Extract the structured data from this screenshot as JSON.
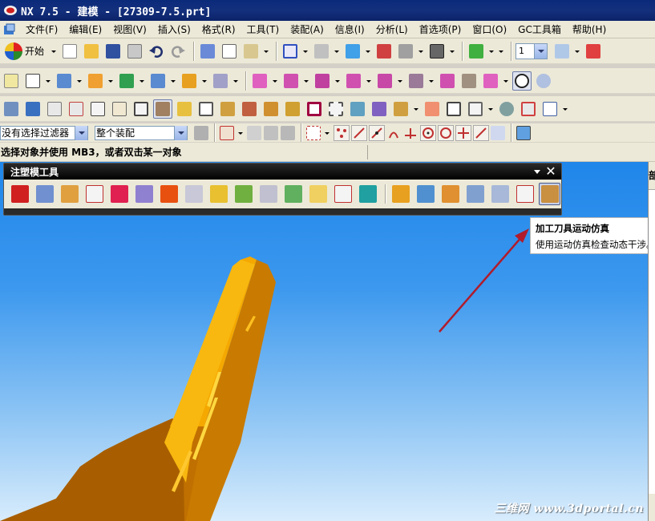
{
  "window": {
    "title": "NX 7.5 - 建模 - [27309-7.5.prt]"
  },
  "menu": [
    "文件(F)",
    "编辑(E)",
    "视图(V)",
    "插入(S)",
    "格式(R)",
    "工具(T)",
    "装配(A)",
    "信息(I)",
    "分析(L)",
    "首选项(P)",
    "窗口(O)",
    "GC工具箱",
    "帮助(H)"
  ],
  "toolbar1": {
    "start_label": "开始",
    "layer_combo_value": "1"
  },
  "selection": {
    "filter_value": "没有选择过滤器",
    "scope_value": "整个装配"
  },
  "status": {
    "prompt": "选择对象并使用 MB3，或者双击某一对象"
  },
  "floating_toolbar": {
    "title": "注塑模工具",
    "menu_glyph": "▼",
    "close_glyph": "✕"
  },
  "tooltip": {
    "title": "加工刀具运动仿真",
    "description": "使用运动仿真检查动态干涉。"
  },
  "right_panel": {
    "header_char": "部"
  },
  "watermark": "三维网 www.3dportal.cn",
  "colors": {
    "titlebar": "#0a2a7a",
    "viewport_top": "#1f86ea",
    "part": "#f4a800",
    "annotation_arrow": "#b01c2c"
  }
}
